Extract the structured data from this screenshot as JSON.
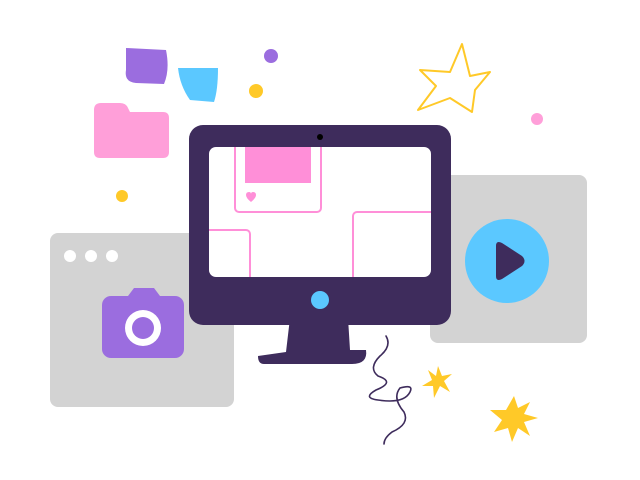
{
  "illustration": {
    "monitor": {
      "frame_color": "#3e2c5c",
      "screen_color": "#ffffff",
      "power_button_color": "#5bc8ff",
      "card_outline_color": "#ff8fd8",
      "card_fill_color": "#ff8fd8"
    },
    "browser_window": {
      "color": "#d3d3d3",
      "dot_color": "#ffffff"
    },
    "camera_icon": {
      "name": "camera-icon",
      "color": "#9b6ddf"
    },
    "video_window": {
      "color": "#d3d3d3"
    },
    "play_icon": {
      "name": "play-icon",
      "circle_color": "#5bc8ff",
      "triangle_color": "#3e2c5c"
    },
    "folder_icon": {
      "name": "folder-icon",
      "color": "#ff9fd9"
    },
    "sticky_notes": [
      {
        "name": "purple-note",
        "color": "#9b6ddf"
      },
      {
        "name": "blue-note",
        "color": "#5bc8ff"
      }
    ],
    "decorations": {
      "dot_yellow": "#ffc928",
      "dot_purple": "#9b6ddf",
      "dot_pink": "#ff9fd9",
      "star_outline": "#ffc928",
      "sparkle": "#ffc928",
      "squiggle": "#3e2c5c"
    }
  }
}
